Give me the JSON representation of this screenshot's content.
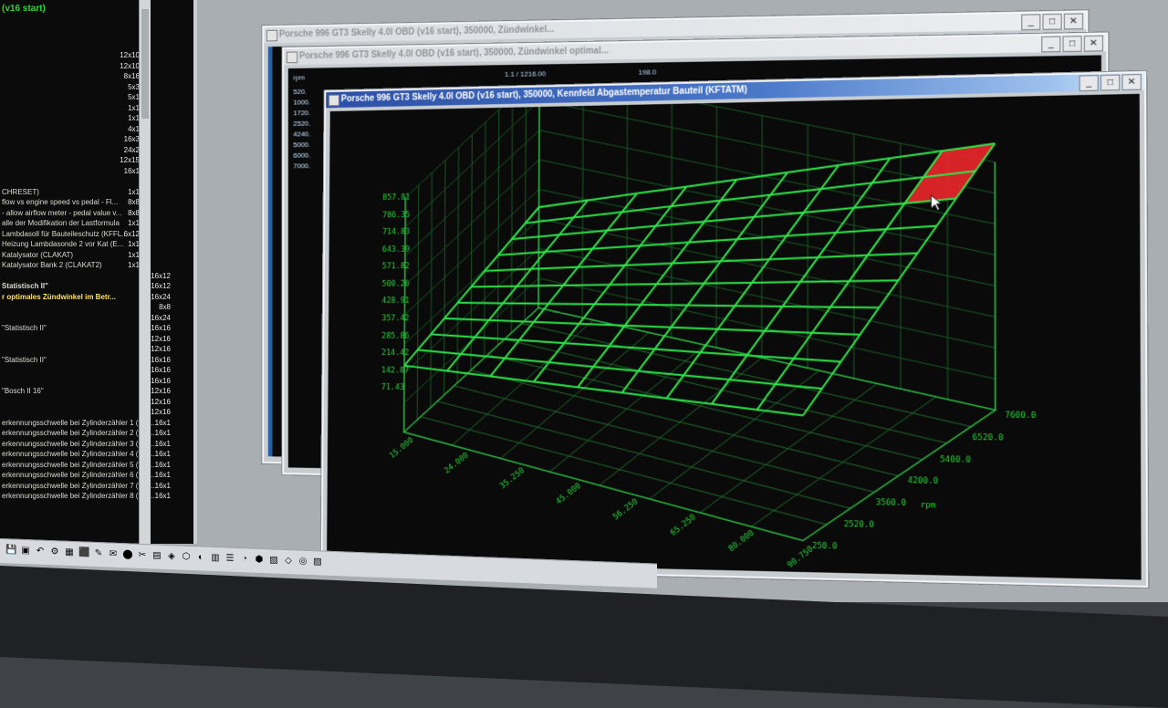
{
  "left_panel": {
    "title": "(v16 start)",
    "rows": [
      {
        "text": "",
        "value": "12x10"
      },
      {
        "text": "",
        "value": "12x10"
      },
      {
        "text": "",
        "value": "8x16"
      },
      {
        "text": "",
        "value": "5x3"
      },
      {
        "text": "",
        "value": "5x1"
      },
      {
        "text": "",
        "value": "1x1"
      },
      {
        "text": "",
        "value": "1x1"
      },
      {
        "text": "",
        "value": "4x1"
      },
      {
        "text": "",
        "value": "16x3"
      },
      {
        "text": "",
        "value": "24x2"
      },
      {
        "text": "",
        "value": "12x15"
      },
      {
        "text": "",
        "value": "16x1"
      },
      {
        "text": "",
        "value": ""
      },
      {
        "text": "CHRESET)",
        "value": "1x1"
      },
      {
        "text": "flow vs engine speed vs pedal - Fl...",
        "value": "8x8"
      },
      {
        "text": "- allow airflow meter - pedal value v...",
        "value": "8x8"
      },
      {
        "text": "alle der Modifikation der Lastformula",
        "value": "1x1"
      },
      {
        "text": "Lambdasoll für Bauteileschutz (KFFL...",
        "value": "6x12"
      },
      {
        "text": "Heizung Lambdasonde 2 vor Kat (E...",
        "value": "1x1"
      },
      {
        "text": "Katalysator (CLAKAT)",
        "value": "1x1"
      },
      {
        "text": "Katalysator Bank 2 (CLAKAT2)",
        "value": "1x1"
      },
      {
        "text": "",
        "value": "16x12"
      },
      {
        "text": "Statistisch II\"",
        "value": "16x12",
        "bold": true
      },
      {
        "text": "r optimales Zündwinkel im Betr...",
        "value": "16x24",
        "yellow": true
      },
      {
        "text": "",
        "value": "8x8"
      },
      {
        "text": "",
        "value": "16x24"
      },
      {
        "text": "\"Statistisch II\"",
        "value": "16x16"
      },
      {
        "text": "",
        "value": "12x16"
      },
      {
        "text": "",
        "value": "12x16"
      },
      {
        "text": "\"Statistisch II\"",
        "value": "16x16"
      },
      {
        "text": "",
        "value": "16x16"
      },
      {
        "text": "",
        "value": "16x16"
      },
      {
        "text": "\"Bosch II 16\"",
        "value": "12x16"
      },
      {
        "text": "",
        "value": "12x16"
      },
      {
        "text": "",
        "value": "12x16"
      },
      {
        "text": "erkennungsschwelle bei Zylinderzähler 1 (f/2 -...",
        "value": "16x1"
      },
      {
        "text": "erkennungsschwelle bei Zylinderzähler 2 (f/2 -...",
        "value": "16x1"
      },
      {
        "text": "erkennungsschwelle bei Zylinderzähler 3 (f/2 -...",
        "value": "16x1"
      },
      {
        "text": "erkennungsschwelle bei Zylinderzähler 4 (f/2 -...",
        "value": "16x1"
      },
      {
        "text": "erkennungsschwelle bei Zylinderzähler 5 (f/2 -...",
        "value": "16x1"
      },
      {
        "text": "erkennungsschwelle bei Zylinderzähler 6 (f/2 -...",
        "value": "16x1"
      },
      {
        "text": "erkennungsschwelle bei Zylinderzähler 7 (f/2 -...",
        "value": "16x1"
      },
      {
        "text": "erkennungsschwelle bei Zylinderzähler 8 (f/2 -...",
        "value": "16x1"
      }
    ]
  },
  "windows": {
    "back1_title": "Porsche 996 GT3 Skelly 4.0l OBD (v16 start), 350000, Zündwinkel...",
    "back2_title": "Porsche 996 GT3 Skelly 4.0l OBD (v16 start), 350000, Zündwinkel optimal...",
    "back2_header_left": "rpm",
    "back2_header_mid": "1.1 / 1216.00",
    "back2_header_right": "198.0",
    "back2_rows": [
      "520.",
      "1000.",
      "1720.",
      "2520.",
      "4240.",
      "5000.",
      "6000.",
      "7000."
    ],
    "front_title": "Porsche 996 GT3 Skelly 4.0l OBD (v16 start), 350000, Kennfeld Abgastemperatur Bauteil (KFTATM)"
  },
  "buttons": {
    "minimize": "_",
    "maximize": "□",
    "close": "✕"
  },
  "chart_data": {
    "type": "surface3d",
    "z_ticks": [
      "71.43",
      "142.87",
      "214.42",
      "285.86",
      "357.42",
      "428.91",
      "500.26",
      "571.82",
      "643.39",
      "714.83",
      "786.35",
      "857.81"
    ],
    "x_ticks": [
      "15.000",
      "24.000",
      "35.250",
      "45.000",
      "56.250",
      "65.250",
      "80.000",
      "90.750"
    ],
    "y_ticks": [
      "250.0",
      "2520.0",
      "3560.0",
      "4200.0",
      "5400.0",
      "6520.0",
      "7600.0"
    ],
    "y_axis_label": "rpm",
    "surface_rows": 11,
    "surface_cols": 10,
    "highlight_cell": {
      "row": 1,
      "col": 8
    },
    "colors": {
      "grid": "#2ee84a",
      "highlight": "#e8262a",
      "background": "#0a0a0a",
      "axis_text": "#27d43a"
    }
  }
}
